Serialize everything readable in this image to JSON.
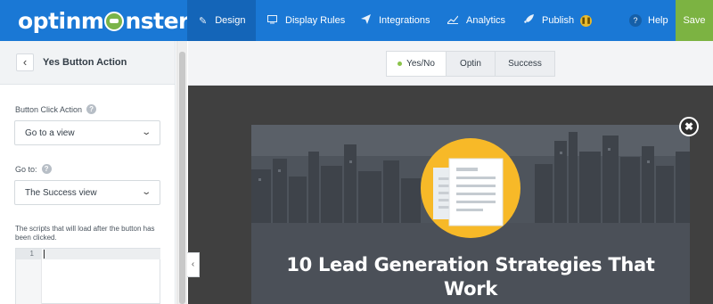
{
  "topbar": {
    "logo": {
      "before": "optinm",
      "after": "nster"
    },
    "nav": [
      {
        "label": "Design",
        "icon": "pencil-icon"
      },
      {
        "label": "Display Rules",
        "icon": "monitor-icon"
      },
      {
        "label": "Integrations",
        "icon": "paper-plane-icon"
      },
      {
        "label": "Analytics",
        "icon": "chart-line-icon"
      },
      {
        "label": "Publish",
        "icon": "rocket-icon",
        "status_icon": "pause-icon"
      }
    ],
    "help_label": "Help",
    "save_label": "Save",
    "colors": {
      "bar": "#1a78d5",
      "active": "#1465b8",
      "save": "#7cb342"
    }
  },
  "sidebar": {
    "title": "Yes Button Action",
    "button_click_action": {
      "label": "Button Click Action",
      "value": "Go to a view"
    },
    "go_to": {
      "label": "Go to:",
      "value": "The Success view"
    },
    "scripts_label": "The scripts that will load after the button has been clicked.",
    "editor": {
      "line_number": "1"
    }
  },
  "canvas": {
    "tabs": [
      {
        "label": "Yes/No",
        "active": true
      },
      {
        "label": "Optin",
        "active": false
      },
      {
        "label": "Success",
        "active": false
      }
    ],
    "popup": {
      "title_line1": "10 Lead Generation Strategies That",
      "title_line2": "Work",
      "accent_color": "#f7b928"
    }
  }
}
